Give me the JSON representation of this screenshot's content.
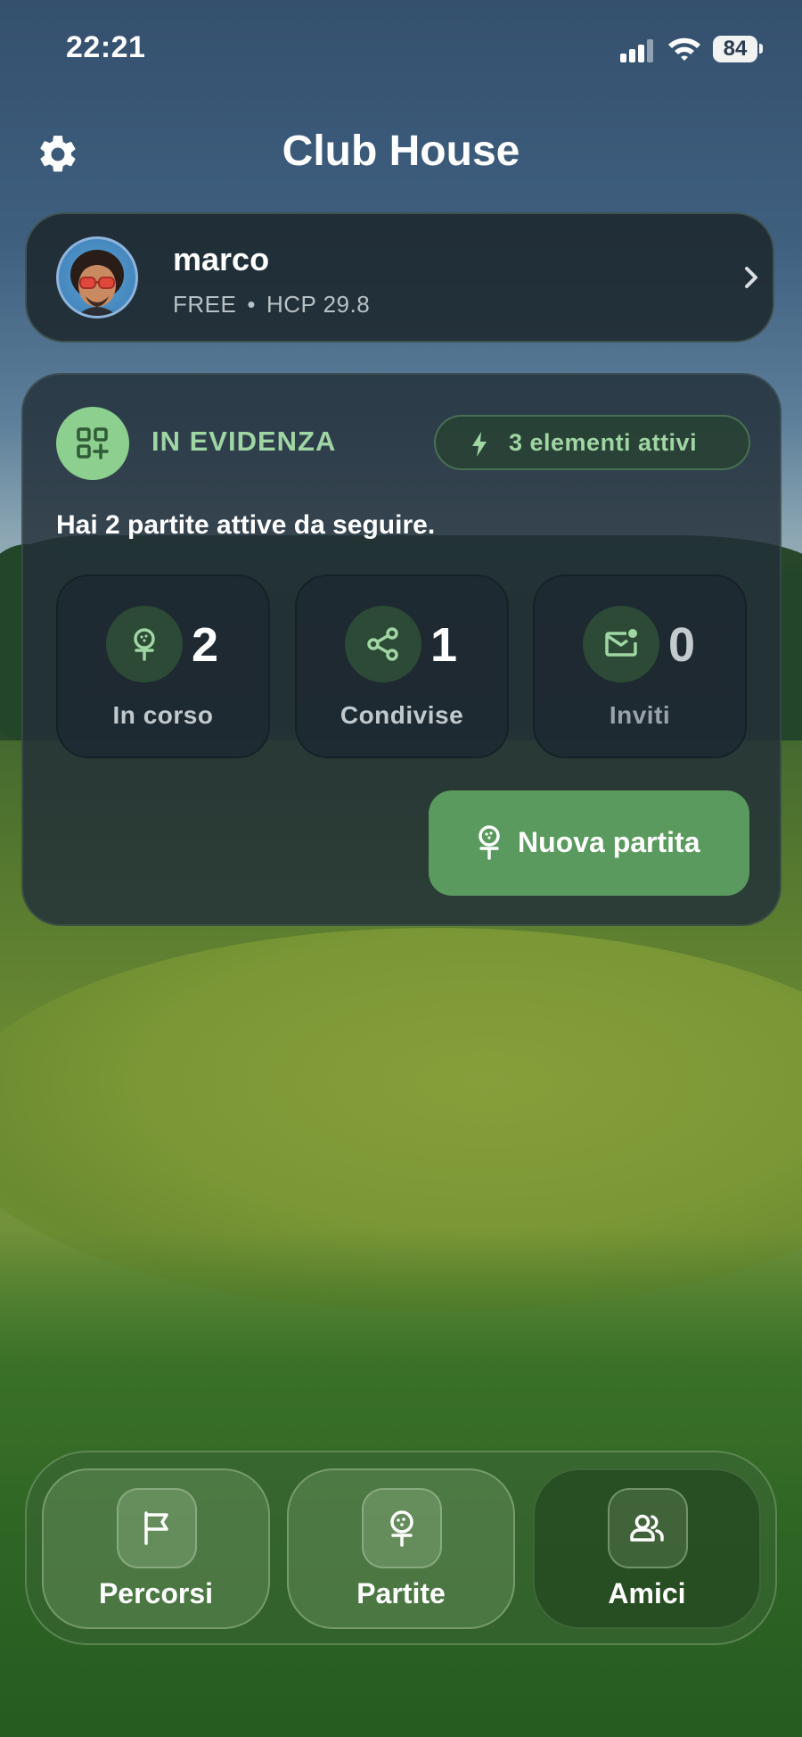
{
  "status_bar": {
    "time": "22:21",
    "battery": "84"
  },
  "header": {
    "title": "Club House",
    "settings_icon": "gear-icon"
  },
  "profile": {
    "name": "marco",
    "plan": "FREE",
    "separator": "•",
    "handicap": "HCP 29.8"
  },
  "featured": {
    "title": "IN EVIDENZA",
    "badge": "3 elementi attivi",
    "message": "Hai 2 partite attive da seguire.",
    "stats": [
      {
        "icon": "golf-tee-icon",
        "value": "2",
        "label": "In corso"
      },
      {
        "icon": "share-icon",
        "value": "1",
        "label": "Condivise"
      },
      {
        "icon": "mail-notification-icon",
        "value": "0",
        "label": "Inviti"
      }
    ],
    "new_match": "Nuova partita"
  },
  "nav": [
    {
      "icon": "flag-icon",
      "label": "Percorsi"
    },
    {
      "icon": "golf-tee-icon",
      "label": "Partite"
    },
    {
      "icon": "friends-icon",
      "label": "Amici"
    }
  ],
  "colors": {
    "accent_green": "#5a9a5e",
    "highlight_green": "#9fd6a3",
    "card_dark": "#222e38"
  }
}
